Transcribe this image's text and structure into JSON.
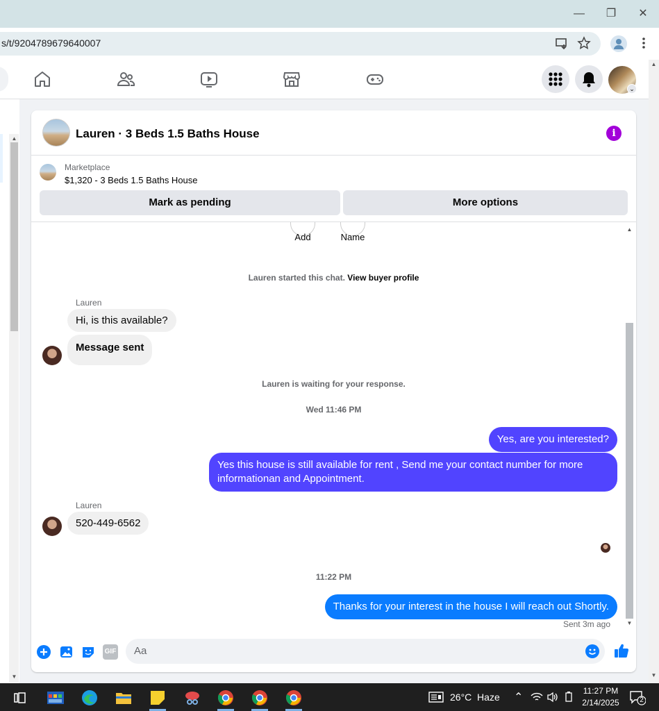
{
  "browser": {
    "url": "s/t/9204789679640007",
    "window_controls": [
      "—",
      "❐",
      "✕"
    ]
  },
  "chat": {
    "title": "Lauren · 3 Beds 1.5 Baths House",
    "marketplace_label": "Marketplace",
    "listing": "$1,320 - 3 Beds 1.5 Baths House",
    "buttons": {
      "pending": "Mark as pending",
      "more": "More options"
    },
    "top_actions": [
      "Add",
      "Name"
    ],
    "started": "Lauren started this chat.",
    "view_profile": "View buyer profile",
    "messages": [
      {
        "sender": "Lauren",
        "text": "Hi, is this available?"
      },
      {
        "text": "Message sent"
      },
      {
        "text": "Lauren is waiting for your response."
      },
      {
        "text": "Wed 11:46 PM"
      },
      {
        "text": "Yes, are you interested?"
      },
      {
        "text": "Yes this house is still available for rent , Send me your contact number for more informationan and Appointment."
      },
      {
        "sender": "Lauren",
        "text": "520-449-6562"
      },
      {
        "text": "11:22 PM"
      },
      {
        "text": "Thanks for your interest in the house I will reach out Shortly."
      },
      {
        "text": "Sent 3m ago"
      }
    ],
    "composer": {
      "placeholder": "Aa",
      "gif": "GIF"
    }
  },
  "taskbar": {
    "weather": "26°C  Haze",
    "time": "11:27 PM",
    "date": "2/14/2025",
    "notif_count": "2"
  },
  "colors": {
    "accent_blue": "#0a7cff",
    "accent_purple": "#5144ff",
    "info_purple": "#a200d9"
  }
}
